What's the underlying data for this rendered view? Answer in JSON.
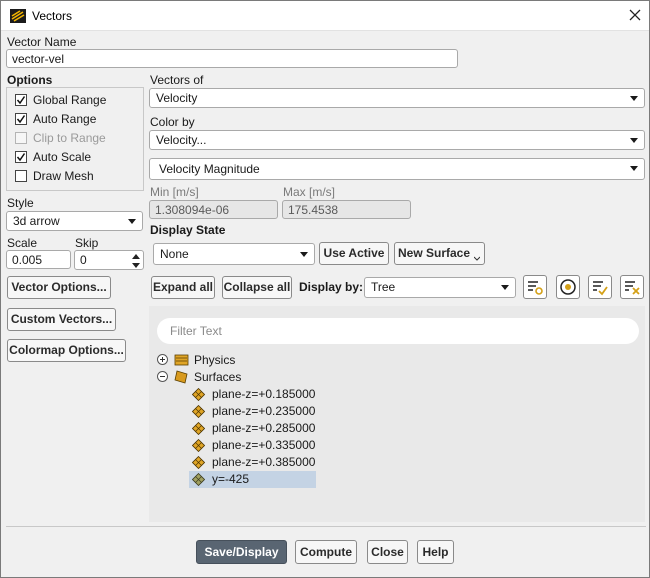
{
  "window": {
    "title": "Vectors"
  },
  "vector_name": {
    "label": "Vector Name",
    "value": "vector-vel"
  },
  "options": {
    "heading": "Options",
    "items": [
      {
        "label": "Global Range",
        "checked": true,
        "enabled": true
      },
      {
        "label": "Auto Range",
        "checked": true,
        "enabled": true
      },
      {
        "label": "Clip to Range",
        "checked": false,
        "enabled": false
      },
      {
        "label": "Auto Scale",
        "checked": true,
        "enabled": true
      },
      {
        "label": "Draw Mesh",
        "checked": false,
        "enabled": true
      }
    ]
  },
  "style": {
    "label": "Style",
    "value": "3d arrow"
  },
  "scale": {
    "label": "Scale",
    "value": "0.005"
  },
  "skip": {
    "label": "Skip",
    "value": "0"
  },
  "left_buttons": {
    "vector_options": "Vector Options...",
    "custom_vectors": "Custom Vectors...",
    "colormap_options": "Colormap Options..."
  },
  "vectors_of": {
    "label": "Vectors of",
    "value": "Velocity"
  },
  "color_by": {
    "label": "Color by",
    "value": "Velocity...",
    "sub_value": "Velocity Magnitude"
  },
  "range": {
    "min_label": "Min [m/s]",
    "min_value": "1.308094e-06",
    "max_label": "Max [m/s]",
    "max_value": "175.4538"
  },
  "display_state": {
    "label": "Display State",
    "value": "None",
    "use_active": "Use Active",
    "new_surface": "New Surface"
  },
  "tree_toolbar": {
    "expand_all": "Expand all",
    "collapse_all": "Collapse all",
    "display_by_label": "Display by:",
    "display_by_value": "Tree"
  },
  "tree": {
    "filter_placeholder": "Filter Text",
    "physics": "Physics",
    "surfaces": "Surfaces",
    "items": [
      {
        "label": "plane-z=+0.185000",
        "selected": false
      },
      {
        "label": "plane-z=+0.235000",
        "selected": false
      },
      {
        "label": "plane-z=+0.285000",
        "selected": false
      },
      {
        "label": "plane-z=+0.335000",
        "selected": false
      },
      {
        "label": "plane-z=+0.385000",
        "selected": false
      },
      {
        "label": "y=-425",
        "selected": true
      }
    ]
  },
  "bottom_buttons": {
    "save_display": "Save/Display",
    "compute": "Compute",
    "close": "Close",
    "help": "Help"
  },
  "colors": {
    "primary_button": "#596572",
    "selection": "#c4d3e4",
    "tree_bg": "#e9e9e9",
    "accent_icon": "#d4a017"
  }
}
